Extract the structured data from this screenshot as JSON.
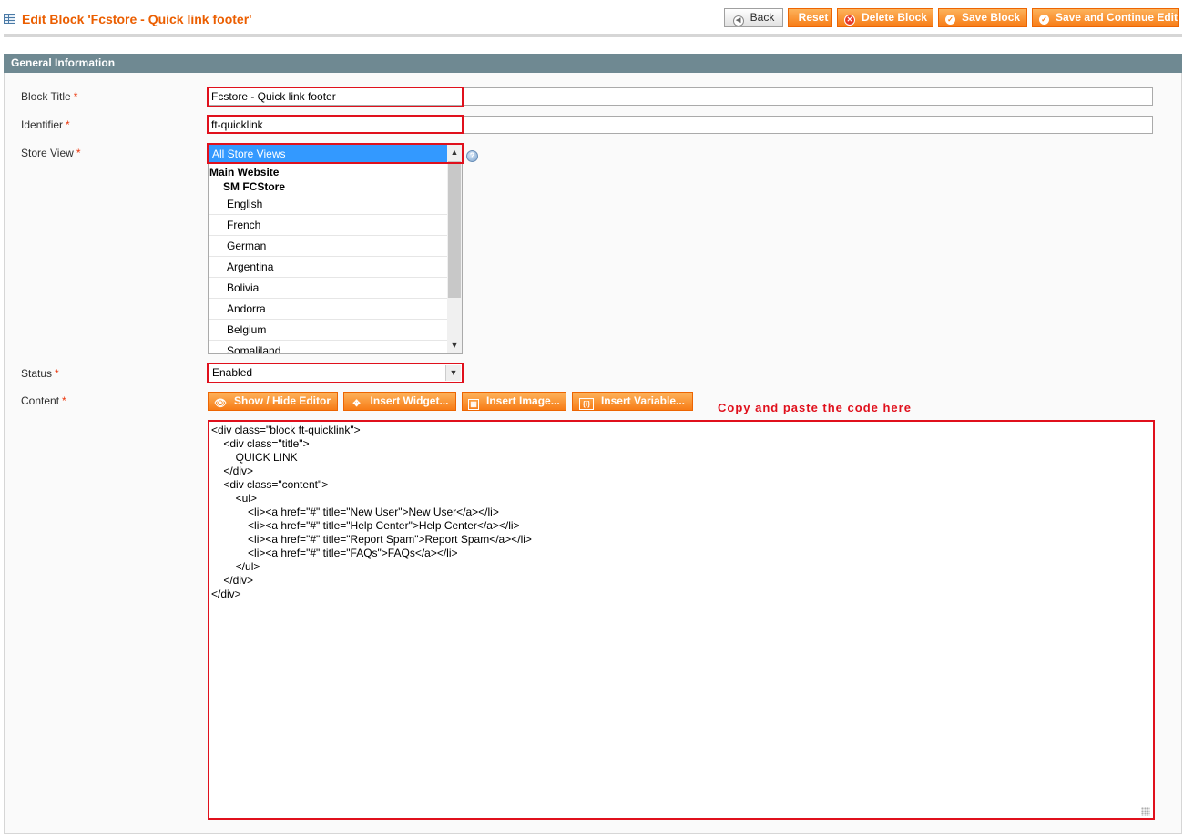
{
  "header": {
    "title": "Edit Block 'Fcstore - Quick link footer'",
    "actions": {
      "back": "Back",
      "reset": "Reset",
      "delete": "Delete Block",
      "save": "Save Block",
      "save_continue": "Save and Continue Edit"
    }
  },
  "fieldset": {
    "legend": "General Information"
  },
  "form": {
    "block_title": {
      "label": "Block Title",
      "required": "*",
      "value": "Fcstore - Quick link footer"
    },
    "identifier": {
      "label": "Identifier",
      "required": "*",
      "value": "ft-quicklink"
    },
    "store_view": {
      "label": "Store View",
      "required": "*",
      "selected": "All Store Views",
      "group_website": "Main Website",
      "group_store": "SM FCStore",
      "options": [
        "English",
        "French",
        "German",
        "Argentina",
        "Bolivia",
        "Andorra",
        "Belgium",
        "Somaliland"
      ]
    },
    "status": {
      "label": "Status",
      "required": "*",
      "value": "Enabled"
    },
    "content": {
      "label": "Content",
      "required": "*",
      "buttons": {
        "show_hide": "Show / Hide Editor",
        "insert_widget": "Insert Widget...",
        "insert_image": "Insert Image...",
        "insert_variable": "Insert Variable..."
      },
      "note": "Copy and paste the code here",
      "code": "<div class=\"block ft-quicklink\">\n\t<div class=\"title\">\n\t\tQUICK LINK\n\t</div>\n\t<div class=\"content\">\n\t\t<ul>\n\t\t\t<li><a href=\"#\" title=\"New User\">New User</a></li>\n\t\t\t<li><a href=\"#\" title=\"Help Center\">Help Center</a></li>\n\t\t\t<li><a href=\"#\" title=\"Report Spam\">Report Spam</a></li>\n\t\t\t<li><a href=\"#\" title=\"FAQs\">FAQs</a></li>\n\t\t</ul>\n\t</div>\n</div>"
    }
  },
  "colors": {
    "accent": "#eb5e00",
    "button_orange": "#f77c16",
    "highlight_red": "#e0101c",
    "fieldset_header": "#6f8992",
    "selected_option": "#3399ff"
  },
  "icons": {
    "title": "grid-icon",
    "back": "arrow-left-icon",
    "delete": "delete-icon",
    "save": "check-icon",
    "help": "help-icon",
    "widget": "widget-icon",
    "image": "image-icon",
    "variable": "variable-icon"
  }
}
